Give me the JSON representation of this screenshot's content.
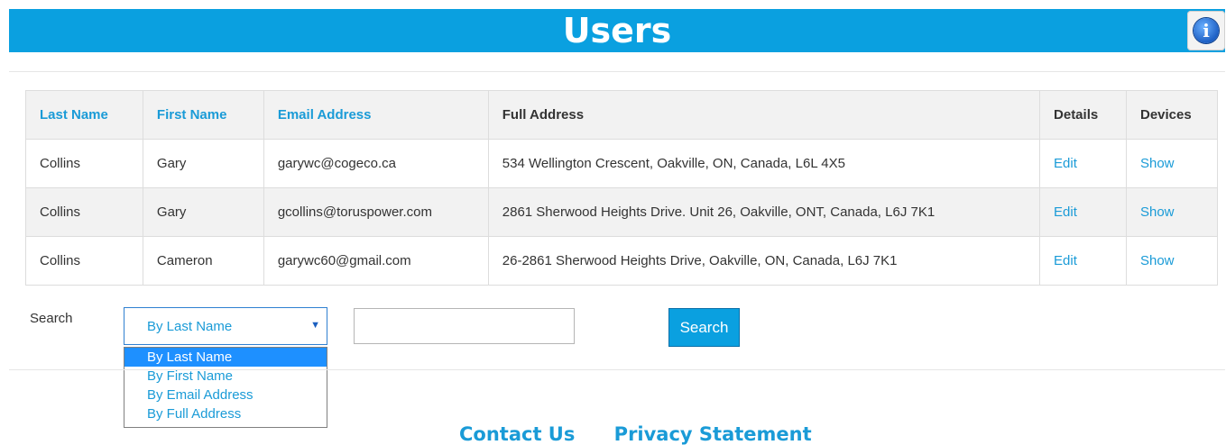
{
  "header": {
    "title": "Users",
    "info_icon": "info-icon"
  },
  "table": {
    "columns": [
      "Last Name",
      "First Name",
      "Email Address",
      "Full Address",
      "Details",
      "Devices"
    ],
    "rows": [
      {
        "last": "Collins",
        "first": "Gary",
        "email": "garywc@cogeco.ca",
        "address": "534 Wellington Crescent, Oakville, ON, Canada, L6L 4X5",
        "details": "Edit",
        "devices": "Show"
      },
      {
        "last": "Collins",
        "first": "Gary",
        "email": "gcollins@toruspower.com",
        "address": "2861 Sherwood Heights Drive. Unit 26, Oakville, ONT, Canada, L6J 7K1",
        "details": "Edit",
        "devices": "Show"
      },
      {
        "last": "Collins",
        "first": "Cameron",
        "email": "garywc60@gmail.com",
        "address": "26-2861 Sherwood Heights Drive, Oakville, ON, Canada, L6J 7K1",
        "details": "Edit",
        "devices": "Show"
      }
    ]
  },
  "search": {
    "label": "Search",
    "selected": "By Last Name",
    "options": [
      "By Last Name",
      "By First Name",
      "By Email Address",
      "By Full Address"
    ],
    "input_value": "",
    "button_label": "Search"
  },
  "footer": {
    "contact": "Contact Us",
    "privacy": "Privacy Statement"
  },
  "colors": {
    "header_bg": "#0aa0e0",
    "link": "#1a9bd7",
    "option_selected": "#1e90ff"
  }
}
